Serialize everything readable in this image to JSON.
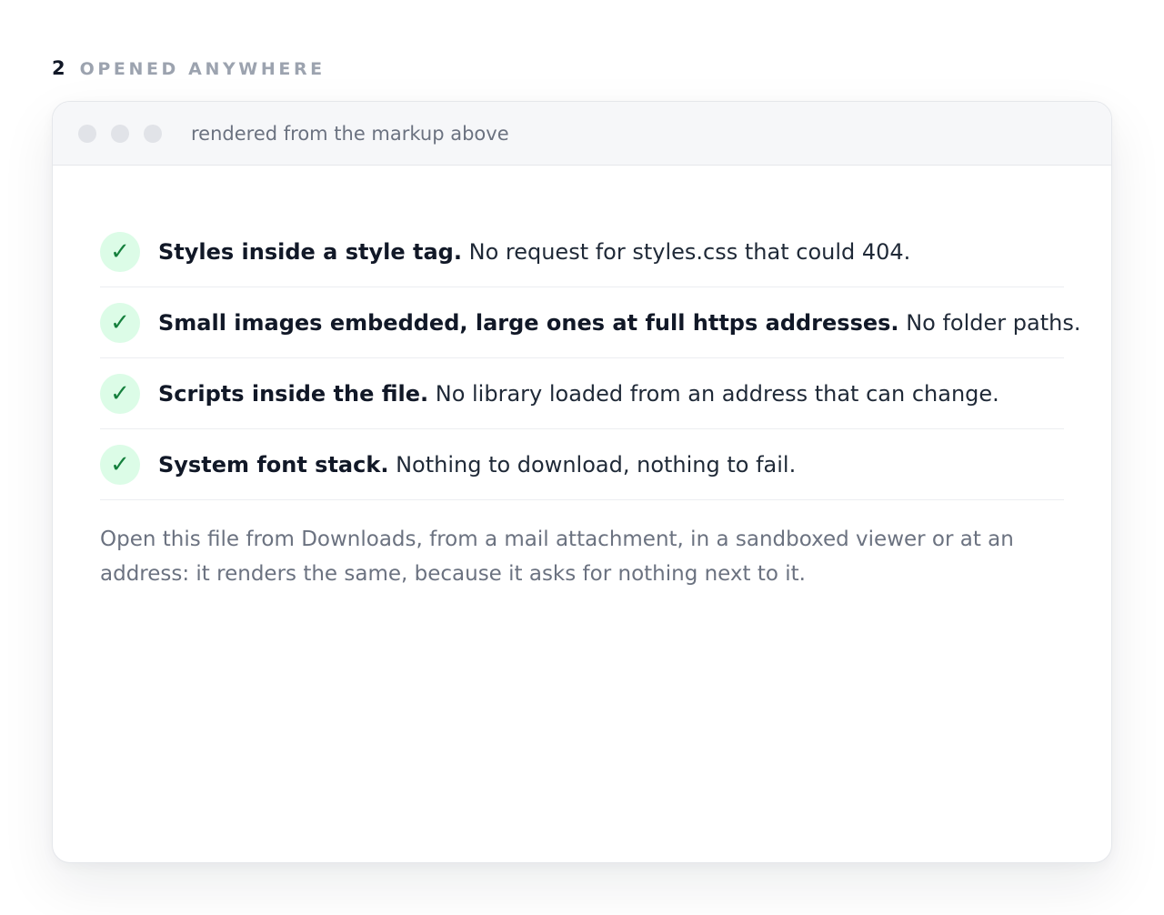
{
  "section": {
    "number": "2",
    "title": "OPENED ANYWHERE"
  },
  "window": {
    "title": "rendered from the markup above",
    "controls": [
      "window-dot",
      "window-dot",
      "window-dot"
    ]
  },
  "checklist": [
    {
      "icon": "check-icon",
      "glyph": "✓",
      "heading": "Styles inside a style tag.",
      "detail": "No request for styles.css that could 404."
    },
    {
      "icon": "check-icon",
      "glyph": "✓",
      "heading": "Small images embedded, large ones at full https addresses.",
      "detail": "No folder paths."
    },
    {
      "icon": "check-icon",
      "glyph": "✓",
      "heading": "Scripts inside the file.",
      "detail": "No library loaded from an address that can change."
    },
    {
      "icon": "check-icon",
      "glyph": "✓",
      "heading": "System font stack.",
      "detail": "Nothing to download, nothing to fail."
    }
  ],
  "footnote": "Open this file from Downloads, from a mail attachment, in a sandboxed viewer or at an address: it renders the same, because it asks for nothing next to it.",
  "colors": {
    "check_badge_bg": "#dcfce7",
    "check_mark": "#15803d",
    "section_title": "#9ca3af",
    "titlebar_bg": "#f6f7f9"
  }
}
